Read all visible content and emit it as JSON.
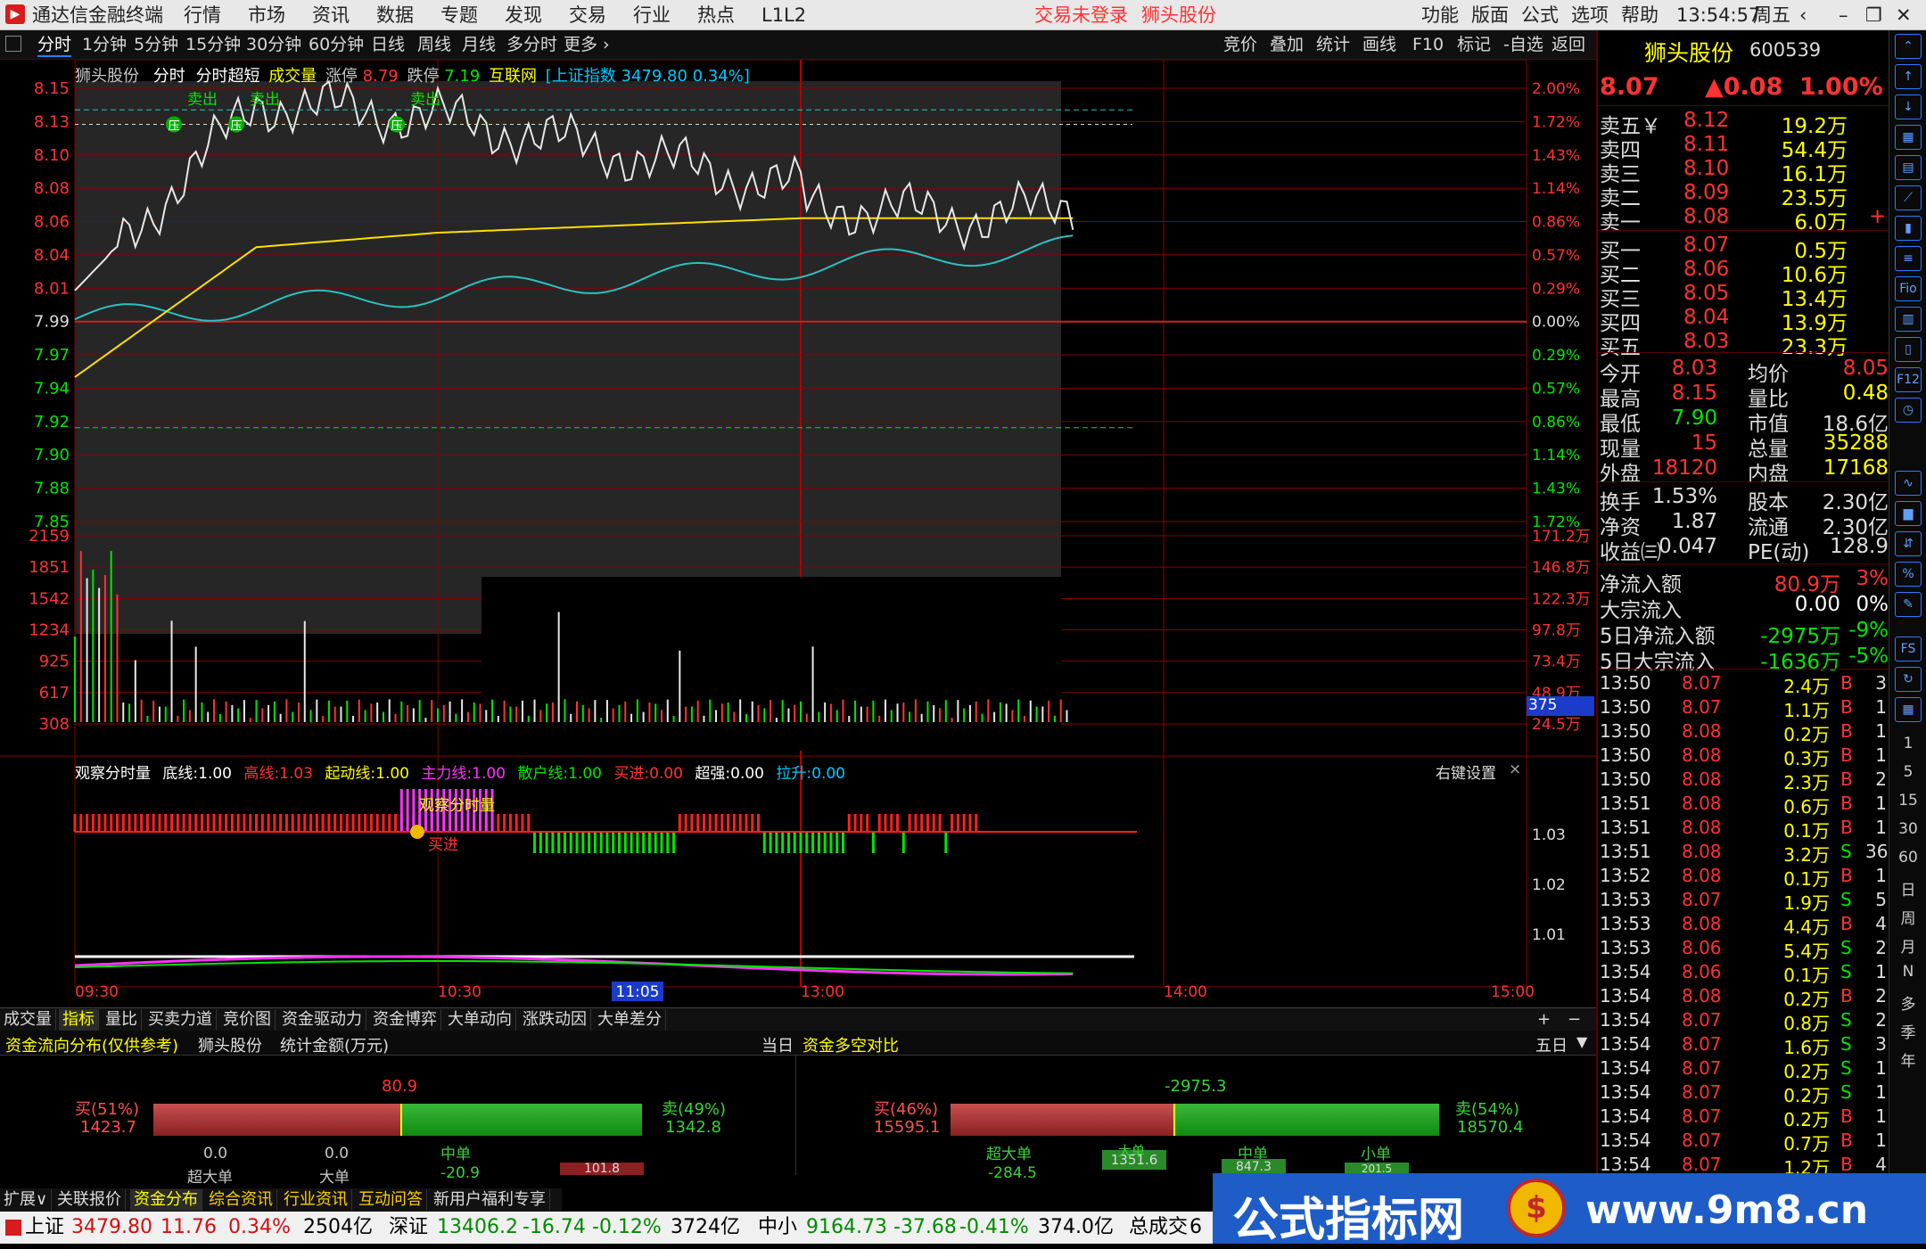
{
  "app": {
    "title": "通达信金融终端",
    "menus": [
      "行情",
      "市场",
      "资讯",
      "数据",
      "专题",
      "发现",
      "交易",
      "行业",
      "热点",
      "L1L2"
    ],
    "alerts": [
      "交易未登录",
      "狮头股份"
    ],
    "right_menus": [
      "功能",
      "版面",
      "公式",
      "选项",
      "帮助"
    ],
    "clock": "13:54:57",
    "weekday": "周五"
  },
  "periods": {
    "items": [
      "分时",
      "1分钟",
      "5分钟",
      "15分钟",
      "30分钟",
      "60分钟",
      "日线",
      "周线",
      "月线",
      "多分时",
      "更多"
    ],
    "active": "分时",
    "tools": [
      "竞价",
      "叠加",
      "统计",
      "画线",
      "F10",
      "标记",
      "-自选",
      "返回"
    ]
  },
  "chart_header": {
    "name": "狮头股份",
    "mode1": "分时",
    "mode2": "分时超短",
    "vol_label": "成交量",
    "limit_up_label": "涨停",
    "limit_up": "8.79",
    "limit_down_label": "跌停",
    "limit_down": "7.19",
    "concept": "互联网",
    "index_text": "[上证指数 3479.80 0.34%]"
  },
  "price_axis": {
    "left": [
      "8.15",
      "8.13",
      "8.10",
      "8.08",
      "8.06",
      "8.04",
      "8.01",
      "7.99",
      "7.97",
      "7.94",
      "7.92",
      "7.90",
      "7.88",
      "7.85"
    ],
    "right": [
      "2.00%",
      "1.72%",
      "1.43%",
      "1.14%",
      "0.86%",
      "0.57%",
      "0.29%",
      "0.00%",
      "0.29%",
      "0.57%",
      "0.86%",
      "1.14%",
      "1.43%",
      "1.72%"
    ]
  },
  "volume_axis": {
    "left": [
      "2159",
      "1851",
      "1542",
      "1234",
      "925",
      "617",
      "308"
    ],
    "right": [
      "171.2万",
      "146.8万",
      "122.3万",
      "97.8万",
      "73.4万",
      "48.9万",
      "24.5万"
    ],
    "cursor_value": "375"
  },
  "chart_marks": {
    "sell": [
      "卖出",
      "卖出",
      "卖出"
    ],
    "press": [
      "压",
      "压",
      "压"
    ]
  },
  "indicator": {
    "name": "观察分时量",
    "params": [
      {
        "label": "底线:",
        "value": "1.00"
      },
      {
        "label": "高线:",
        "value": "1.03"
      },
      {
        "label": "起动线:",
        "value": "1.00"
      },
      {
        "label": "主力线:",
        "value": "1.00"
      },
      {
        "label": "散户线:",
        "value": "1.00"
      },
      {
        "label": "买进:",
        "value": "0.00"
      },
      {
        "label": "超强:",
        "value": "0.00"
      },
      {
        "label": "拉升:",
        "value": "0.00"
      }
    ],
    "settings": "右键设置",
    "box_label": "观察分时量",
    "buy_label": "买进",
    "axis": [
      "1.03",
      "1.02",
      "1.01"
    ]
  },
  "time_axis": [
    "09:30",
    "10:30",
    "11:05",
    "13:00",
    "14:00",
    "15:00"
  ],
  "chart_data": {
    "type": "line",
    "x": [
      "09:30",
      "10:00",
      "10:30",
      "11:00",
      "11:30/13:00",
      "13:30",
      "13:50"
    ],
    "series": [
      {
        "values": [
          8.01,
          8.14,
          8.13,
          8.08,
          8.07,
          8.06,
          8.07
        ]
      },
      {
        "values": [
          7.95,
          8.04,
          8.05,
          8.06,
          8.06,
          8.06,
          8.06
        ]
      }
    ],
    "ylim": [
      7.85,
      8.15
    ],
    "volume_ylim": [
      0,
      2159
    ]
  },
  "bottom_tabs": [
    "成交量",
    "指标",
    "量比",
    "买卖力道",
    "竞价图",
    "资金驱动力",
    "资金博弈",
    "大单动向",
    "涨跌动因",
    "大单差分"
  ],
  "bottom_tabs_active": "指标",
  "fund_flow": {
    "title": "资金流向分布(仅供参考)",
    "stock": "狮头股份",
    "unit": "统计金额(万元)",
    "period": "当日",
    "net": "80.9",
    "buy_label": "买(51%)",
    "buy_value": "1423.7",
    "sell_label": "卖(49%)",
    "sell_value": "1342.8",
    "buy_pct": 51,
    "items": [
      {
        "label": "超大单",
        "value": "0.0"
      },
      {
        "label": "大单",
        "value": "0.0"
      },
      {
        "label": "中单",
        "value": "-20.9"
      },
      {
        "label": "",
        "value": "101.8"
      }
    ]
  },
  "fund_compare": {
    "title": "资金多空对比",
    "period": "五日",
    "net": "-2975.3",
    "buy_label": "买(46%)",
    "buy_value": "15595.1",
    "sell_label": "卖(54%)",
    "sell_value": "18570.4",
    "buy_pct": 46,
    "items": [
      {
        "label": "超大单",
        "value": "-284.5"
      },
      {
        "label": "大单",
        "value": "1351.6"
      },
      {
        "label": "中单",
        "value": "847.3"
      },
      {
        "label": "小单",
        "value": "201.5"
      }
    ]
  },
  "quote": {
    "name": "狮头股份",
    "code": "600539",
    "price": "8.07",
    "change": "▲0.08",
    "pct": "1.00%",
    "asks": [
      {
        "label": "卖五￥",
        "price": "8.12",
        "vol": "19.2万"
      },
      {
        "label": "卖四",
        "price": "8.11",
        "vol": "54.4万"
      },
      {
        "label": "卖三",
        "price": "8.10",
        "vol": "16.1万"
      },
      {
        "label": "卖二",
        "price": "8.09",
        "vol": "23.5万"
      },
      {
        "label": "卖一",
        "price": "8.08",
        "vol": "6.0万",
        "extra": "+1"
      }
    ],
    "bids": [
      {
        "label": "买一",
        "price": "8.07",
        "vol": "0.5万"
      },
      {
        "label": "买二",
        "price": "8.06",
        "vol": "10.6万"
      },
      {
        "label": "买三",
        "price": "8.05",
        "vol": "13.4万"
      },
      {
        "label": "买四",
        "price": "8.04",
        "vol": "13.9万"
      },
      {
        "label": "买五",
        "price": "8.03",
        "vol": "23.3万"
      }
    ],
    "stats": [
      {
        "l1": "今开",
        "v1": "8.03",
        "l2": "均价",
        "v2": "8.05"
      },
      {
        "l1": "最高",
        "v1": "8.15",
        "l2": "量比",
        "v2": "0.48"
      },
      {
        "l1": "最低",
        "v1": "7.90",
        "l2": "市值",
        "v2": "18.6亿"
      },
      {
        "l1": "现量",
        "v1": "15",
        "l2": "总量",
        "v2": "35288"
      },
      {
        "l1": "外盘",
        "v1": "18120",
        "l2": "内盘",
        "v2": "17168"
      }
    ],
    "stats2": [
      {
        "l1": "换手",
        "v1": "1.53%",
        "l2": "股本",
        "v2": "2.30亿"
      },
      {
        "l1": "净资",
        "v1": "1.87",
        "l2": "流通",
        "v2": "2.30亿"
      },
      {
        "l1": "收益㈢",
        "v1": "0.047",
        "l2": "PE(动)",
        "v2": "128.9"
      }
    ],
    "flows": [
      {
        "label": "净流入额",
        "value": "80.9万",
        "pct": "3%"
      },
      {
        "label": "大宗流入",
        "value": "0.00",
        "pct": "0%"
      },
      {
        "label": "5日净流入额",
        "value": "-2975万",
        "pct": "-9%"
      },
      {
        "label": "5日大宗流入",
        "value": "-1636万",
        "pct": "-5%"
      }
    ],
    "trades": [
      [
        "13:50",
        "8.07",
        "2.4万",
        "B",
        "3"
      ],
      [
        "13:50",
        "8.07",
        "1.1万",
        "B",
        "1"
      ],
      [
        "13:50",
        "8.08",
        "0.2万",
        "B",
        "1"
      ],
      [
        "13:50",
        "8.08",
        "0.3万",
        "B",
        "1"
      ],
      [
        "13:50",
        "8.08",
        "2.3万",
        "B",
        "2"
      ],
      [
        "13:51",
        "8.08",
        "0.6万",
        "B",
        "1"
      ],
      [
        "13:51",
        "8.08",
        "0.1万",
        "B",
        "1"
      ],
      [
        "13:51",
        "8.08",
        "3.2万",
        "S",
        "36"
      ],
      [
        "13:52",
        "8.08",
        "0.1万",
        "B",
        "1"
      ],
      [
        "13:53",
        "8.07",
        "1.9万",
        "S",
        "5"
      ],
      [
        "13:53",
        "8.08",
        "4.4万",
        "B",
        "4"
      ],
      [
        "13:53",
        "8.06",
        "5.4万",
        "S",
        "2"
      ],
      [
        "13:54",
        "8.06",
        "0.1万",
        "S",
        "1"
      ],
      [
        "13:54",
        "8.08",
        "0.2万",
        "B",
        "2"
      ],
      [
        "13:54",
        "8.07",
        "0.8万",
        "S",
        "2"
      ],
      [
        "13:54",
        "8.07",
        "1.6万",
        "S",
        "3"
      ],
      [
        "13:54",
        "8.07",
        "0.2万",
        "S",
        "1"
      ],
      [
        "13:54",
        "8.07",
        "0.2万",
        "S",
        "1"
      ],
      [
        "13:54",
        "8.07",
        "0.2万",
        "B",
        "1"
      ],
      [
        "13:54",
        "8.07",
        "0.7万",
        "B",
        "1"
      ],
      [
        "13:54",
        "8.07",
        "1.2万",
        "B",
        "4"
      ]
    ]
  },
  "side_icons": [
    "1",
    "5",
    "15",
    "30",
    "60",
    "日",
    "周",
    "月",
    "N",
    "多",
    "季",
    "年"
  ],
  "lower_tabs": [
    "扩展∨",
    "关联报价",
    "资金分布",
    "综合资讯",
    "行业资讯",
    "互动问答",
    "新用户福利专享"
  ],
  "lower_tabs_active": "资金分布",
  "status": {
    "idx1": {
      "name": "上证",
      "price": "3479.80",
      "chg": "11.76",
      "pct": "0.34%",
      "amt": "2504亿"
    },
    "idx2": {
      "name": "深证",
      "price": "13406.2",
      "chg": "-16.74",
      "pct": "-0.12%",
      "amt": "3724亿"
    },
    "idx3": {
      "name": "中小",
      "price": "9164.73",
      "chg": "-37.68",
      "pct": "-0.41%",
      "amt": "374.0亿"
    },
    "idx4": {
      "name": "总成交",
      "price": "6"
    }
  },
  "watermark": {
    "text": "公式指标网",
    "url": "www.9m8.cn"
  }
}
